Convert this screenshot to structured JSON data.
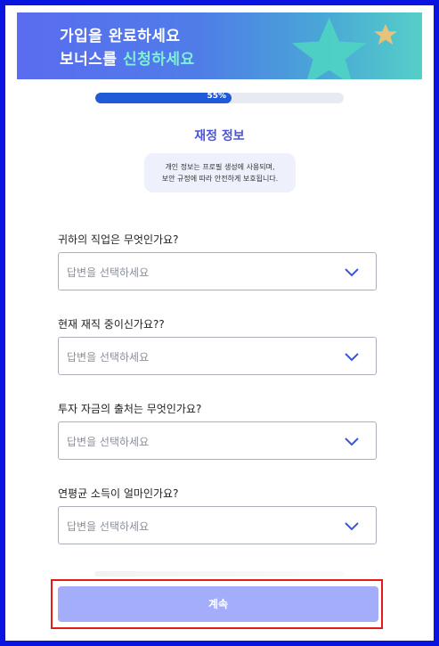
{
  "banner": {
    "line1": "가입을 완료하세요",
    "line2_prefix": "보너스를 ",
    "line2_accent": "신청하세요"
  },
  "progress": {
    "label": "55%",
    "value": 0.55
  },
  "section": {
    "title": "재정 정보",
    "notice_line1": "개인 정보는 프로필 생성에 사용되며,",
    "notice_line2": "보안 규정에 따라 안전하게 보호됩니다."
  },
  "questions": [
    {
      "label": "귀하의 직업은 무엇인가요?",
      "placeholder": "답변을 선택하세요"
    },
    {
      "label": "현재 재직 중이신가요??",
      "placeholder": "답변을 선택하세요"
    },
    {
      "label": "투자 자금의 출처는 무엇인가요?",
      "placeholder": "답변을 선택하세요"
    },
    {
      "label": "연평균 소득이 얼마인가요?",
      "placeholder": "답변을 선택하세요"
    }
  ],
  "continue_label": "계속",
  "colors": {
    "accent": "#4a55d8",
    "progress_fill": "#1f5ad8",
    "button": "#a4adfa",
    "highlight_border": "#e11a1a"
  }
}
